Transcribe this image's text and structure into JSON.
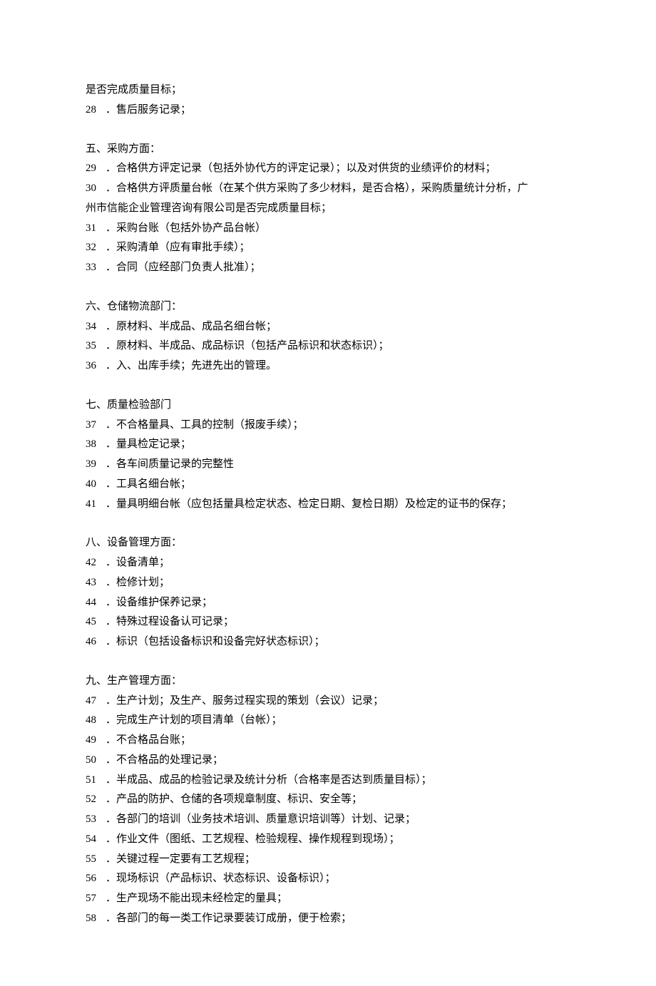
{
  "intro_lines": [
    "是否完成质量目标；"
  ],
  "intro_numbered": [
    {
      "num": "28",
      "text": "．售后服务记录；"
    }
  ],
  "sections": [
    {
      "heading": "五、采购方面：",
      "items": [
        {
          "num": "29",
          "text": "．合格供方评定记录（包括外协代方的评定记录）；以及对供货的业绩评价的材料；"
        },
        {
          "num": "30",
          "text": "．合格供方评质量台帐（在某个供方采购了多少材料，是否合格），采购质量统计分析，广"
        }
      ],
      "continuation": "州市信能企业管理咨询有限公司是否完成质量目标；",
      "items_after": [
        {
          "num": "31",
          "text": "．采购台账（包括外协产品台帐）"
        },
        {
          "num": "32",
          "text": "．采购清单（应有审批手续）；"
        },
        {
          "num": "33",
          "text": "．合同（应经部门负责人批准）；"
        }
      ]
    },
    {
      "heading": "六、仓储物流部门：",
      "items": [
        {
          "num": "34",
          "text": "．原材料、半成品、成品名细台帐；"
        },
        {
          "num": "35",
          "text": "．原材料、半成品、成品标识（包括产品标识和状态标识）；"
        },
        {
          "num": "36",
          "text": "．入、出库手续；先进先出的管理。"
        }
      ]
    },
    {
      "heading": "七、质量检验部门",
      "items": [
        {
          "num": "37",
          "text": "．不合格量具、工具的控制（报废手续）；"
        },
        {
          "num": "38",
          "text": "．量具检定记录；"
        },
        {
          "num": "39",
          "text": "．各车间质量记录的完整性"
        },
        {
          "num": "40",
          "text": "．工具名细台帐；"
        },
        {
          "num": "41",
          "text": "．量具明细台帐（应包括量具检定状态、检定日期、复检日期）及检定的证书的保存；"
        }
      ]
    },
    {
      "heading": "八、设备管理方面：",
      "items": [
        {
          "num": "42",
          "text": "．设备清单；"
        },
        {
          "num": "43",
          "text": "．检修计划；"
        },
        {
          "num": "44",
          "text": "．设备维护保养记录；"
        },
        {
          "num": "45",
          "text": "．特殊过程设备认可记录；"
        },
        {
          "num": "46",
          "text": "．标识（包括设备标识和设备完好状态标识）；"
        }
      ]
    },
    {
      "heading": "九、生产管理方面：",
      "items": [
        {
          "num": "47",
          "text": "．生产计划；及生产、服务过程实现的策划（会议）记录；"
        },
        {
          "num": "48",
          "text": "．完成生产计划的项目清单（台帐）；"
        },
        {
          "num": "49",
          "text": "．不合格品台账；"
        },
        {
          "num": "50",
          "text": "．不合格品的处理记录；"
        },
        {
          "num": "51",
          "text": "．半成品、成品的检验记录及统计分析（合格率是否达到质量目标）；"
        },
        {
          "num": "52",
          "text": "．产品的防护、仓储的各项规章制度、标识、安全等；"
        },
        {
          "num": "53",
          "text": "．各部门的培训（业务技术培训、质量意识培训等）计划、记录；"
        },
        {
          "num": "54",
          "text": "．作业文件（图纸、工艺规程、检验规程、操作规程到现场）；"
        },
        {
          "num": "55",
          "text": "．关键过程一定要有工艺规程；"
        },
        {
          "num": "56",
          "text": "．现场标识（产品标识、状态标识、设备标识）；"
        },
        {
          "num": "57",
          "text": "．生产现场不能出现未经检定的量具；"
        },
        {
          "num": "58",
          "text": "．各部门的每一类工作记录要装订成册，便于检索；"
        }
      ]
    }
  ]
}
